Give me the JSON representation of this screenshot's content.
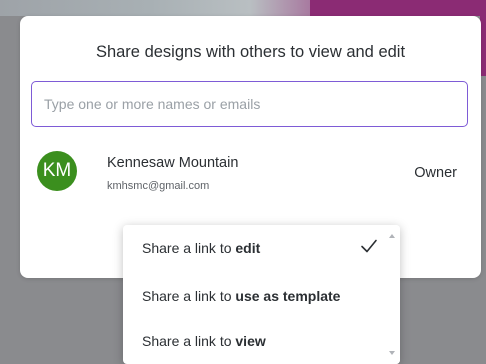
{
  "dialog": {
    "title": "Share designs with others to view and edit",
    "search": {
      "placeholder": "Type one or more names or emails",
      "value": ""
    },
    "member": {
      "initials": "KM",
      "name": "Kennesaw Mountain",
      "email": "kmhsmc@gmail.com",
      "role": "Owner",
      "avatar_color": "#3b8f1e"
    }
  },
  "link_menu": {
    "items": [
      {
        "prefix": "Share a link to ",
        "bold": "edit",
        "selected": true
      },
      {
        "prefix": "Share a link to ",
        "bold": "use as template",
        "selected": false
      },
      {
        "prefix": "Share a link to ",
        "bold": "view",
        "selected": false
      }
    ]
  },
  "colors": {
    "focus_border": "#7e5bd6",
    "accent_background": "#8b2b74"
  }
}
